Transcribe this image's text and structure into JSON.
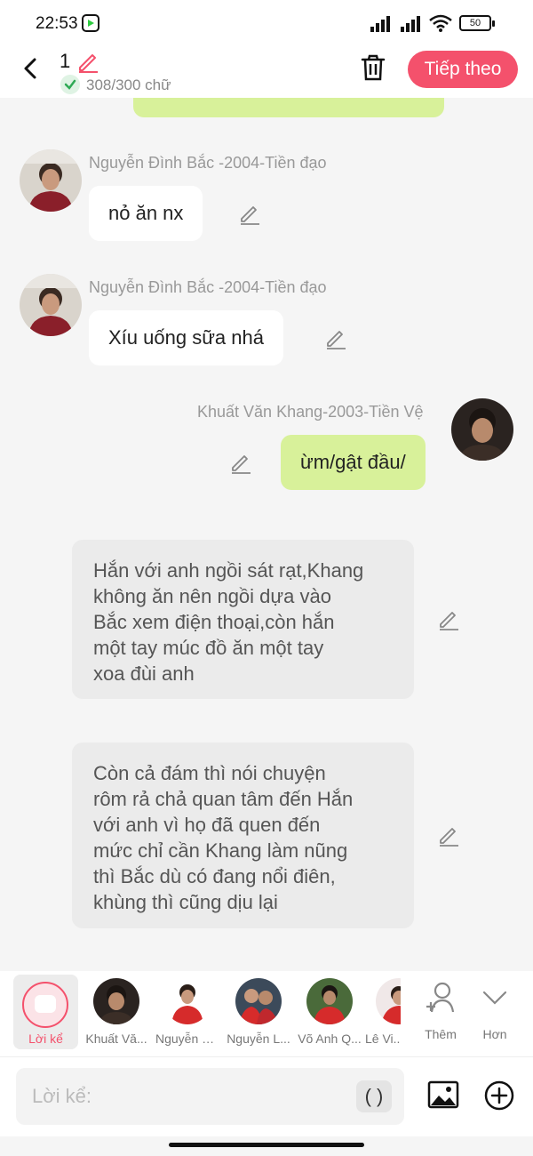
{
  "status_bar": {
    "time": "22:53",
    "battery": "50"
  },
  "header": {
    "chapter_number": "1",
    "word_count": "308/300 chữ",
    "next_button": "Tiếp theo",
    "accent_color": "#f4516c"
  },
  "messages": [
    {
      "type": "incoming",
      "sender": "Nguyễn Đình Bắc -2004-Tiền đạo",
      "text": "nỏ ăn nx"
    },
    {
      "type": "incoming",
      "sender": "Nguyễn Đình Bắc -2004-Tiền đạo",
      "text": "Xíu uống sữa nhá"
    },
    {
      "type": "outgoing",
      "sender": "Khuất Văn Khang-2003-Tiền Vệ",
      "text": "ừm/gật đầu/"
    },
    {
      "type": "narration",
      "lines": [
        "Hắn với anh ngồi sát rạt,Khang",
        "không ăn nên ngồi dựa vào",
        "Bắc xem điện thoại,còn hắn",
        "một tay múc đồ ăn một tay",
        "xoa đùi anh"
      ]
    },
    {
      "type": "narration",
      "lines": [
        "Còn cả đám thì nói chuyện",
        "rôm rả chả quan tâm đến Hắn",
        "với anh vì họ đã quen đến",
        "mức chỉ cần Khang làm nũng",
        "thì Bắc dù có đang nổi điên,",
        "khùng thì cũng dịu lại"
      ]
    }
  ],
  "character_bar": {
    "narrator_label": "Lời kể",
    "characters": [
      {
        "label": "Khuất Vă..."
      },
      {
        "label": "Nguyễn N..."
      },
      {
        "label": "Nguyễn L..."
      },
      {
        "label": "Võ Anh Q..."
      },
      {
        "label": "Lê Vi..."
      }
    ],
    "add_label": "Thêm",
    "more_label": "Hơn"
  },
  "input": {
    "placeholder": "Lời kể:",
    "paren_button": "( )"
  }
}
